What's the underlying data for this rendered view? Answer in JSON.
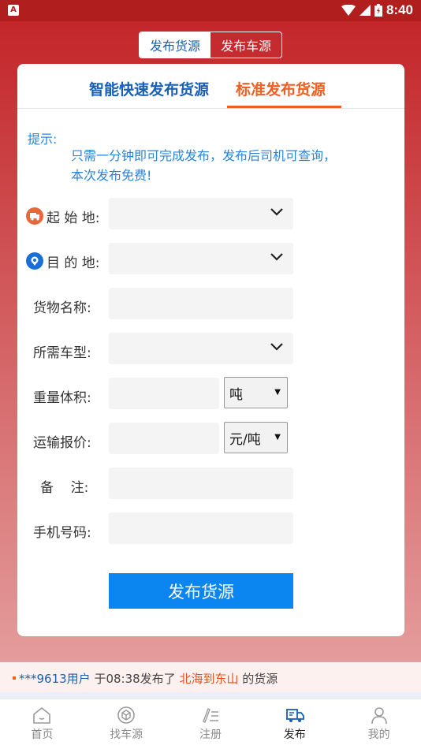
{
  "status_bar": {
    "time": "8:40"
  },
  "top_toggle": {
    "publish_goods": "发布货源",
    "publish_vehicles": "发布车源"
  },
  "tabs": {
    "smart": "智能快速发布货源",
    "standard": "标准发布货源"
  },
  "hint": {
    "label": "提示:",
    "line1": "只需一分钟即可完成发布，发布后司机可查询，",
    "line2": "本次发布免费!"
  },
  "form": {
    "origin_label": "起 始 地:",
    "destination_label": "目 的 地:",
    "goods_name_label": "货物名称:",
    "vehicle_type_label": "所需车型:",
    "weight_volume_label": "重量体积:",
    "weight_unit": "吨",
    "price_label": "运输报价:",
    "price_unit": "元/吨",
    "remark_label": "备    注:",
    "phone_label": "手机号码:",
    "submit": "发布货源"
  },
  "ticker": {
    "user": "***9613用户",
    "mid": " 于08:38发布了 ",
    "route": "北海到东山",
    "tail": " 的货源"
  },
  "bottom_nav": [
    {
      "label": "首页",
      "icon": "home-icon"
    },
    {
      "label": "找车源",
      "icon": "box-icon"
    },
    {
      "label": "注册",
      "icon": "edit-list-icon"
    },
    {
      "label": "发布",
      "icon": "truck-icon"
    },
    {
      "label": "我的",
      "icon": "person-icon"
    }
  ],
  "colors": {
    "brand_red": "#c3262a",
    "blue": "#1a5fb4",
    "orange": "#ee5f21",
    "button": "#0b86f0"
  }
}
